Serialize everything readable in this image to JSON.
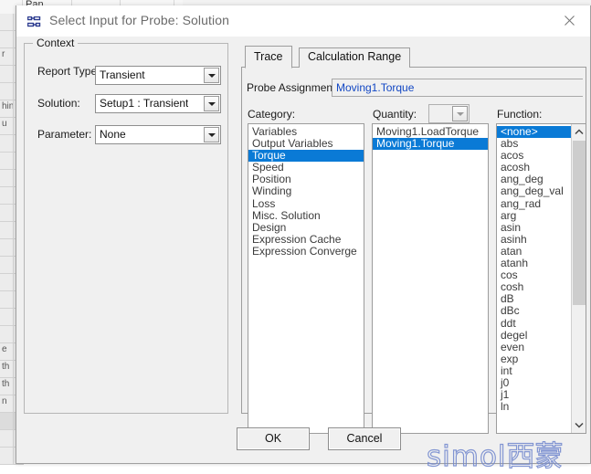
{
  "background": {
    "toolbar_label": "Pan",
    "tree_rows": [
      "",
      "",
      "r",
      "",
      "",
      "hin",
      "u",
      "",
      "",
      "",
      "",
      "",
      "",
      "",
      "",
      "",
      "",
      "",
      "",
      "e",
      "th",
      "th",
      "n",
      "",
      "",
      ""
    ]
  },
  "dialog": {
    "title": "Select Input for Probe: Solution",
    "title_icon": "probe-solution-icon",
    "close_icon": "close-icon"
  },
  "context": {
    "group_title": "Context",
    "report_type_label": "Report Type:",
    "report_type_value": "Transient",
    "solution_label": "Solution:",
    "solution_value": "Setup1 : Transient",
    "parameter_label": "Parameter:",
    "parameter_value": "None"
  },
  "tabs": [
    {
      "label": "Trace",
      "active": true
    },
    {
      "label": "Calculation Range",
      "active": false
    }
  ],
  "trace": {
    "probe_assignment_label": "Probe Assignment:",
    "probe_assignment_value": "Moving1.Torque",
    "category_label": "Category:",
    "quantity_label": "Quantity:",
    "quantity_combo_value": "",
    "function_label": "Function:",
    "category_items": [
      "Variables",
      "Output Variables",
      "Torque",
      "Speed",
      "Position",
      "Winding",
      "Loss",
      "Misc. Solution",
      "Design",
      "Expression Cache",
      "Expression Converge"
    ],
    "category_selected_index": 2,
    "quantity_items": [
      "Moving1.LoadTorque",
      "Moving1.Torque"
    ],
    "quantity_selected_index": 1,
    "function_items": [
      "<none>",
      "abs",
      "acos",
      "acosh",
      "ang_deg",
      "ang_deg_val",
      "ang_rad",
      "arg",
      "asin",
      "asinh",
      "atan",
      "atanh",
      "cos",
      "cosh",
      "dB",
      "dBc",
      "ddt",
      "degel",
      "even",
      "exp",
      "int",
      "j0",
      "j1",
      "ln"
    ],
    "function_selected_index": 0
  },
  "buttons": {
    "ok_label": "OK",
    "cancel_label": "Cancel"
  },
  "watermark": {
    "latin": "simol",
    "cjk": "西蒙"
  },
  "colors": {
    "selection_blue": "#0a7ad6",
    "probe_text_blue": "#1247c4",
    "watermark_blue": "#6f86cd",
    "dialog_face": "#f0f0f0"
  }
}
